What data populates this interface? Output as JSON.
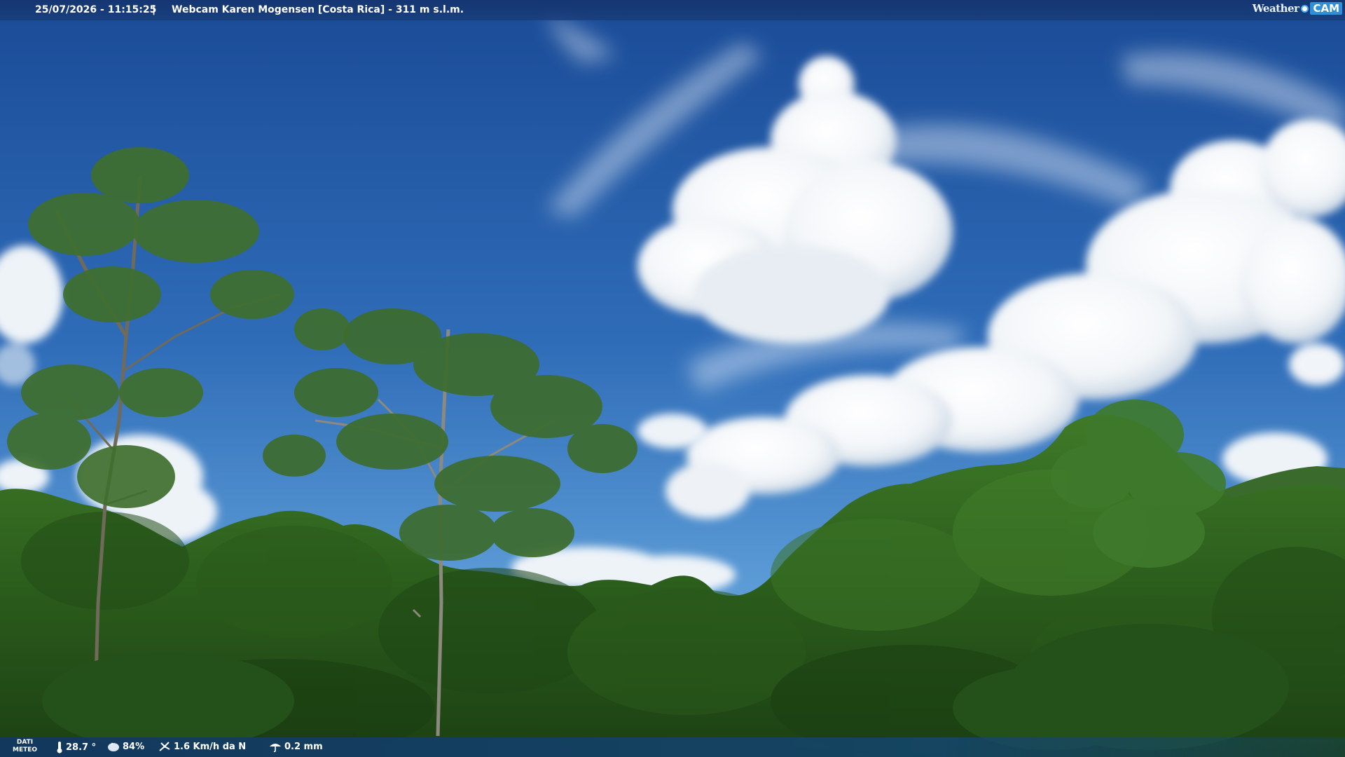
{
  "header": {
    "datetime": "25/07/2026 - 11:15:25",
    "separator": "|",
    "title": "Webcam Karen Mogensen [Costa Rica]  - 311 m s.l.m."
  },
  "brand": {
    "word": "Weather",
    "cam": "CAM",
    "accent": "#2f8fd8"
  },
  "weather": {
    "label_line1": "DATI",
    "label_line2": "METEO",
    "temperature": "28.7 °",
    "humidity": "84%",
    "wind": "1.6 Km/h da N",
    "rain": "0.2 mm",
    "icons": [
      "thermometer-icon",
      "humidity-icon",
      "wind-icon",
      "rain-icon"
    ]
  },
  "colors": {
    "sky_top": "#1c4f9a",
    "sky_bottom": "#5a9ad6",
    "forest": "#2d5a1e"
  }
}
